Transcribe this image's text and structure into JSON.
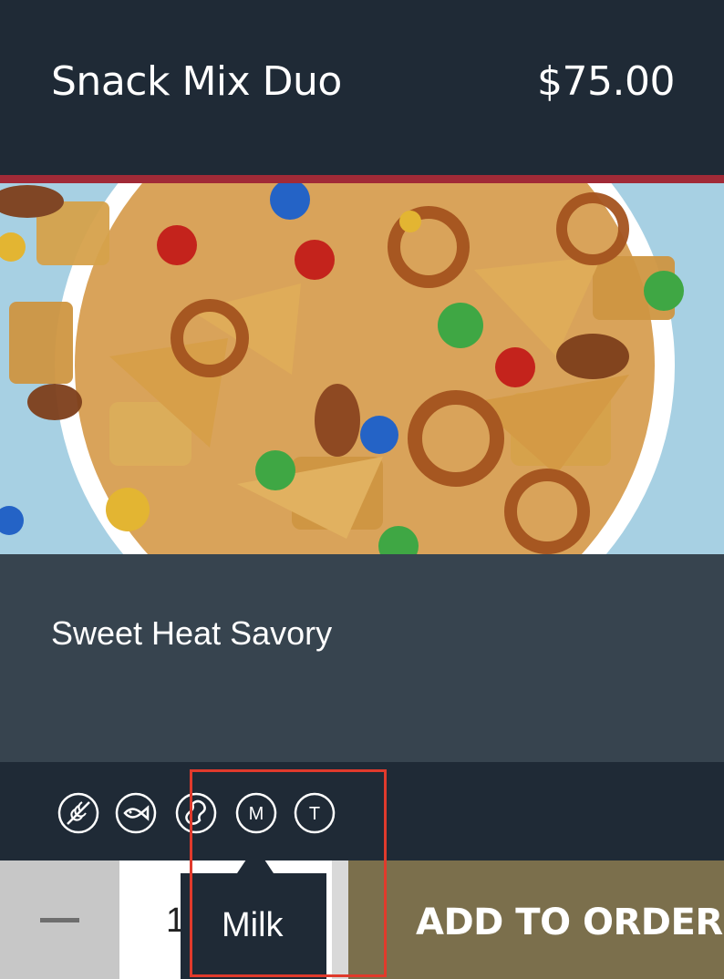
{
  "product": {
    "name": "Snack Mix Duo",
    "price": "$75.00",
    "description": "Sweet Heat Savory",
    "image_alt": "bowl of snack mix"
  },
  "allergens": [
    {
      "icon": "wheat-icon",
      "label": "Wheat"
    },
    {
      "icon": "fish-icon",
      "label": "Fish"
    },
    {
      "icon": "peanut-icon",
      "label": "Peanut"
    },
    {
      "icon": "milk-icon",
      "label": "M"
    },
    {
      "icon": "tree-nut-icon",
      "label": "T"
    }
  ],
  "tooltip": {
    "text": "Milk"
  },
  "quantity": {
    "value": "1"
  },
  "actions": {
    "add_to_order": "ADD TO ORDER"
  },
  "colors": {
    "header_bg": "#1f2a36",
    "accent": "#a12a37",
    "panel_bg": "#37444f",
    "button_bg": "#7b6f4c",
    "highlight": "#e03a2c"
  }
}
